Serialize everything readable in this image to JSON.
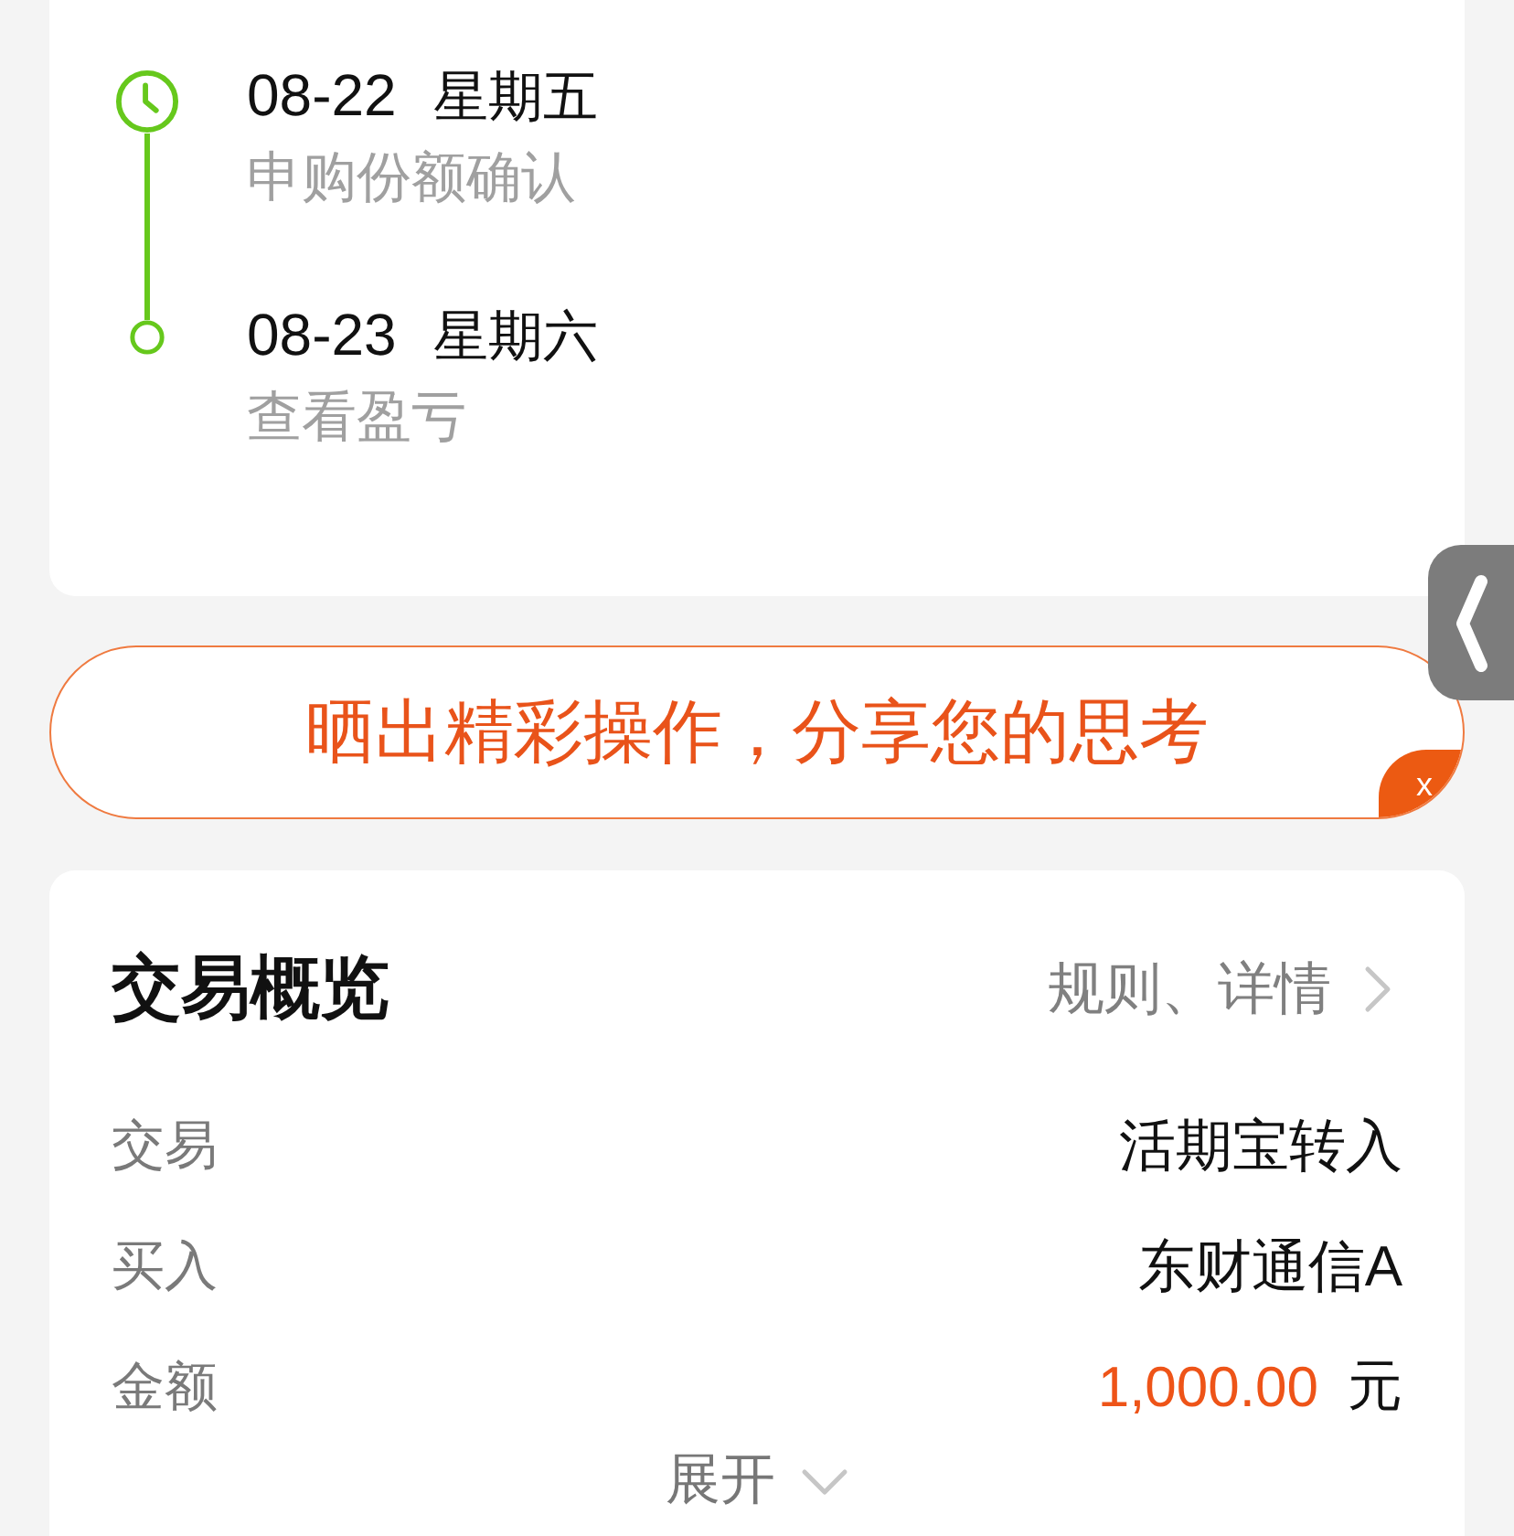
{
  "timeline": {
    "steps": [
      {
        "date": "08-22",
        "weekday": "星期五",
        "description": "申购份额确认",
        "current": true
      },
      {
        "date": "08-23",
        "weekday": "星期六",
        "description": "查看盈亏",
        "current": false
      }
    ]
  },
  "share_banner": {
    "text": "晒出精彩操作，分享您的思考",
    "close_label": "x"
  },
  "trade_overview": {
    "title": "交易概览",
    "link": "规则、详情",
    "rows": [
      {
        "kind": "text",
        "label": "交易",
        "value": "活期宝转入"
      },
      {
        "kind": "text",
        "label": "买入",
        "value": "东财通信A"
      },
      {
        "kind": "amount",
        "label": "金额",
        "value": "1,000.00",
        "unit": "元"
      }
    ],
    "expand_label": "展开"
  }
}
